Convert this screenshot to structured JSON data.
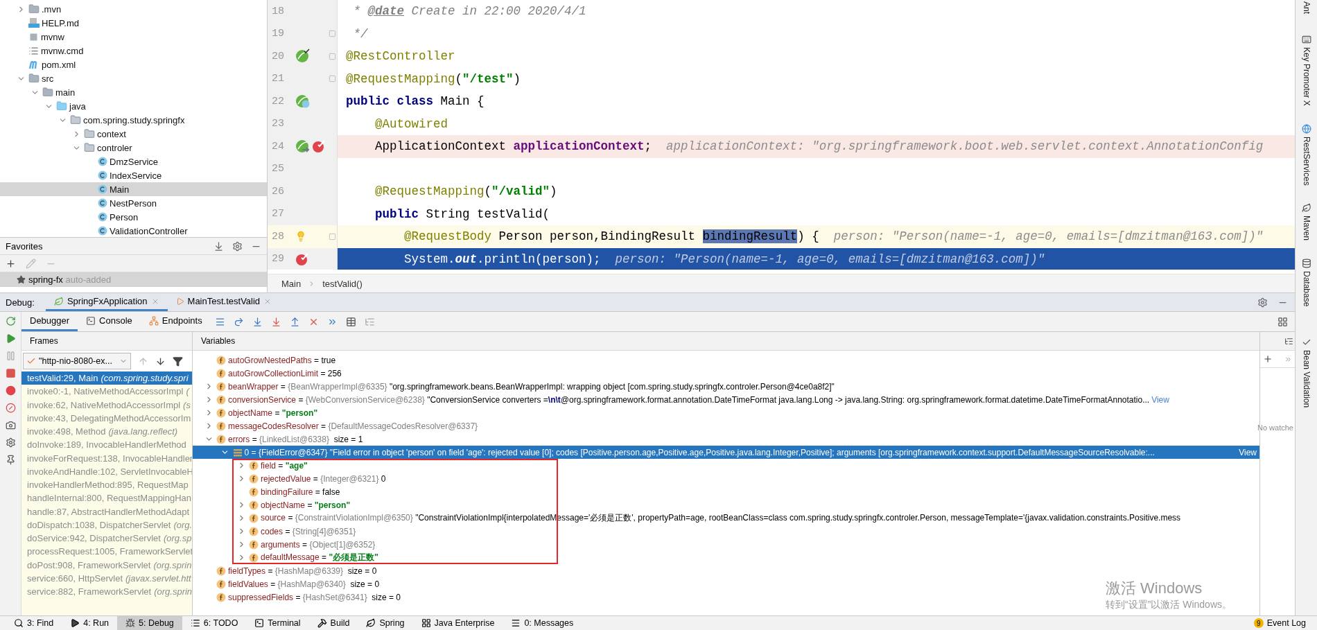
{
  "project": {
    "tree": [
      {
        "label": ".mvn",
        "kind": "folder",
        "expanded": false,
        "selected": false
      },
      {
        "label": "HELP.md",
        "kind": "markdown",
        "selected": false
      },
      {
        "label": "mvnw",
        "kind": "script",
        "selected": false
      },
      {
        "label": "mvnw.cmd",
        "kind": "cmd",
        "selected": false
      },
      {
        "label": "pom.xml",
        "kind": "maven",
        "selected": false
      },
      {
        "label": "src",
        "kind": "folder",
        "expanded": true,
        "selected": false,
        "children": [
          {
            "label": "main",
            "kind": "folder",
            "expanded": true,
            "selected": false,
            "children": [
              {
                "label": "java",
                "kind": "source-folder",
                "expanded": true,
                "selected": false,
                "children": [
                  {
                    "label": "com.spring.study.springfx",
                    "kind": "package",
                    "expanded": true,
                    "selected": false,
                    "children": [
                      {
                        "label": "context",
                        "kind": "package",
                        "expanded": false,
                        "selected": false
                      },
                      {
                        "label": "controler",
                        "kind": "package",
                        "expanded": true,
                        "selected": false,
                        "children": [
                          {
                            "label": "DmzService",
                            "kind": "class",
                            "selected": false
                          },
                          {
                            "label": "IndexService",
                            "kind": "class",
                            "selected": false
                          },
                          {
                            "label": "Main",
                            "kind": "class",
                            "selected": true
                          },
                          {
                            "label": "NestPerson",
                            "kind": "class",
                            "selected": false
                          },
                          {
                            "label": "Person",
                            "kind": "class",
                            "selected": false
                          },
                          {
                            "label": "ValidationController",
                            "kind": "class",
                            "selected": false
                          }
                        ]
                      }
                    ]
                  }
                ]
              }
            ]
          }
        ]
      }
    ]
  },
  "favorites": {
    "title": "Favorites",
    "items": [
      {
        "label": "spring-fx",
        "note": "auto-added",
        "selected": true
      }
    ]
  },
  "editor": {
    "lines": [
      {
        "number": "18",
        "kind": "normal",
        "segments": [
          {
            "kind": "comment",
            "text": " * "
          },
          {
            "kind": "doctag",
            "text": "@date"
          },
          {
            "kind": "comment",
            "text": " Create in 22:00 2020/4/1"
          }
        ]
      },
      {
        "number": "19",
        "kind": "normal",
        "fold": true,
        "segments": [
          {
            "kind": "comment",
            "text": " */"
          }
        ]
      },
      {
        "number": "20",
        "kind": "normal",
        "fold": true,
        "gutter": [
          {
            "kind": "bean-check"
          }
        ],
        "segments": [
          {
            "kind": "annotation",
            "text": "@RestController"
          }
        ]
      },
      {
        "number": "21",
        "kind": "normal",
        "fold": true,
        "segments": [
          {
            "kind": "annotation",
            "text": "@RequestMapping"
          },
          {
            "kind": "plain",
            "text": "("
          },
          {
            "kind": "string",
            "text": "\"/test\""
          },
          {
            "kind": "plain",
            "text": ")"
          }
        ]
      },
      {
        "number": "22",
        "kind": "normal",
        "gutter": [
          {
            "kind": "bean-class"
          }
        ],
        "segments": [
          {
            "kind": "keyword",
            "text": "public class"
          },
          {
            "kind": "plain",
            "text": " Main {"
          }
        ]
      },
      {
        "number": "23",
        "kind": "normal",
        "segments": [
          {
            "kind": "annotation",
            "text": "    @Autowired"
          }
        ]
      },
      {
        "number": "24",
        "kind": "breakpoint",
        "gutter": [
          {
            "kind": "bean-arrow"
          },
          {
            "kind": "breakpoint"
          }
        ],
        "segments": [
          {
            "kind": "plain",
            "text": "    ApplicationContext "
          },
          {
            "kind": "field",
            "text": "applicationContext"
          },
          {
            "kind": "plain",
            "text": ";"
          }
        ],
        "hint": "applicationContext: \"org.springframework.boot.web.servlet.context.AnnotationConfig"
      },
      {
        "number": "25",
        "kind": "normal"
      },
      {
        "number": "26",
        "kind": "normal",
        "segments": [
          {
            "kind": "annotation",
            "text": "    @RequestMapping"
          },
          {
            "kind": "plain",
            "text": "("
          },
          {
            "kind": "string",
            "text": "\"/valid\""
          },
          {
            "kind": "plain",
            "text": ")"
          }
        ]
      },
      {
        "number": "27",
        "kind": "normal",
        "segments": [
          {
            "kind": "keyword",
            "text": "    public"
          },
          {
            "kind": "plain",
            "text": " String testValid("
          }
        ]
      },
      {
        "number": "28",
        "kind": "current",
        "fold": true,
        "gutter": [
          {
            "kind": "bulb"
          }
        ],
        "segments": [
          {
            "kind": "annotation",
            "text": "        @RequestBody"
          },
          {
            "kind": "plain",
            "text": " Person person,BindingResult "
          },
          {
            "kind": "selection",
            "text": "bindingResult"
          },
          {
            "kind": "plain",
            "text": ") {"
          }
        ],
        "hint": "person: \"Person(name=-1, age=0, emails=[dmzitman@163.com])\""
      },
      {
        "number": "29",
        "kind": "execution",
        "gutter": [
          {
            "kind": "breakpoint"
          }
        ],
        "segments": [
          {
            "kind": "plain",
            "text": "        System."
          },
          {
            "kind": "static",
            "text": "out"
          },
          {
            "kind": "plain",
            "text": ".println(person);"
          }
        ],
        "hint": "person: \"Person(name=-1, age=0, emails=[dmzitman@163.com])\""
      }
    ],
    "breadcrumb": [
      "Main",
      "testValid()"
    ]
  },
  "right_toolbar": {
    "top": [
      "Ant",
      "Key Promoter X",
      "RestServices",
      "Maven",
      "Database"
    ],
    "bottom": [
      "Bean Validation"
    ]
  },
  "debug": {
    "label": "Debug:",
    "sessions": [
      {
        "label": "SpringFxApplication",
        "kind": "app",
        "selected": true
      },
      {
        "label": "MainTest.testValid",
        "kind": "test",
        "selected": false
      }
    ],
    "tabs": [
      {
        "label": "Debugger",
        "kind": "debugger",
        "selected": true
      },
      {
        "label": "Console",
        "kind": "console",
        "selected": false
      },
      {
        "label": "Endpoints",
        "kind": "endpoints",
        "selected": false
      }
    ],
    "frames": {
      "title": "Frames",
      "thread": "\"http-nio-8080-ex...",
      "items": [
        {
          "method": "testValid:29, Main",
          "package": "(com.spring.study.spri",
          "selected": true
        },
        {
          "method": "invoke0:-1, NativeMethodAccessorImpl",
          "package": "(",
          "selected": false
        },
        {
          "method": "invoke:62, NativeMethodAccessorImpl",
          "package": "(s",
          "selected": false
        },
        {
          "method": "invoke:43, DelegatingMethodAccessorIm",
          "selected": false
        },
        {
          "method": "invoke:498, Method",
          "package": "(java.lang.reflect)",
          "selected": false
        },
        {
          "method": "doInvoke:189, InvocableHandlerMethod",
          "selected": false
        },
        {
          "method": "invokeForRequest:138, InvocableHandler",
          "selected": false
        },
        {
          "method": "invokeAndHandle:102, ServletInvocableH",
          "selected": false
        },
        {
          "method": "invokeHandlerMethod:895, RequestMap",
          "selected": false
        },
        {
          "method": "handleInternal:800, RequestMappingHan",
          "selected": false
        },
        {
          "method": "handle:87, AbstractHandlerMethodAdapt",
          "selected": false
        },
        {
          "method": "doDispatch:1038, DispatcherServlet",
          "package": "(org.",
          "selected": false
        },
        {
          "method": "doService:942, DispatcherServlet",
          "package": "(org.sp",
          "selected": false
        },
        {
          "method": "processRequest:1005, FrameworkServlet",
          "selected": false
        },
        {
          "method": "doPost:908, FrameworkServlet",
          "package": "(org.sprin",
          "selected": false
        },
        {
          "method": "service:660, HttpServlet",
          "package": "(javax.servlet.htt",
          "selected": false
        },
        {
          "method": "service:882, FrameworkServlet",
          "package": "(org.sprin",
          "selected": false
        }
      ]
    },
    "variables": {
      "title": "Variables",
      "items": [
        {
          "name": "autoGrowNestedPaths",
          "kind": "field",
          "op": "=",
          "value": "true",
          "string": false,
          "selected": false
        },
        {
          "name": "autoGrowCollectionLimit",
          "kind": "field",
          "op": "=",
          "value": "256",
          "string": false,
          "selected": false
        },
        {
          "name": "beanWrapper",
          "kind": "field",
          "op": "=",
          "type": "{BeanWrapperImpl@6335}",
          "value": "\"org.springframework.beans.BeanWrapperImpl: wrapping object [com.spring.study.springfx.controler.Person@4ce0a8f2]\"",
          "string": false,
          "expanded": false,
          "selected": false
        },
        {
          "name": "conversionService",
          "kind": "field",
          "op": "=",
          "type": "{WebConversionService@6238}",
          "value": "\"ConversionService converters =**\\n\\t**@org.springframework.format.annotation.DateTimeFormat java.lang.Long -> java.lang.String: org.springframework.format.datetime.DateTimeFormatAnnotatio...",
          "string": false,
          "link": "View",
          "expanded": false,
          "selected": false
        },
        {
          "name": "objectName",
          "kind": "field",
          "op": "=",
          "value": "\"person\"",
          "string": true,
          "expanded": false,
          "selected": false
        },
        {
          "name": "messageCodesResolver",
          "kind": "field",
          "op": "=",
          "type": "{DefaultMessageCodesResolver@6337}",
          "expanded": false,
          "selected": false
        },
        {
          "name": "errors",
          "kind": "field",
          "op": "=",
          "type": "{LinkedList@6338}",
          "extra": "size = 1",
          "expanded": true,
          "selected": false,
          "children": [
            {
              "name": "0",
              "kind": "element",
              "op": "=",
              "type": "{FieldError@6347}",
              "value": "\"Field error in object 'person' on field 'age': rejected value [0]; codes [Positive.person.age,Positive.age,Positive.java.lang.Integer,Positive]; arguments [org.springframework.context.support.DefaultMessageSourceResolvable:...",
              "string": false,
              "link": "View",
              "expanded": true,
              "selected": true,
              "outlined": true,
              "children": [
                {
                  "name": "field",
                  "kind": "field",
                  "op": "=",
                  "value": "\"age\"",
                  "string": true,
                  "expanded": false,
                  "selected": false
                },
                {
                  "name": "rejectedValue",
                  "kind": "field",
                  "op": "=",
                  "type": "{Integer@6321}",
                  "value": "0",
                  "string": false,
                  "expanded": false,
                  "selected": false
                },
                {
                  "name": "bindingFailure",
                  "kind": "field",
                  "op": "=",
                  "value": "false",
                  "string": false,
                  "selected": false
                },
                {
                  "name": "objectName",
                  "kind": "field",
                  "op": "=",
                  "value": "\"person\"",
                  "string": true,
                  "expanded": false,
                  "selected": false
                },
                {
                  "name": "source",
                  "kind": "field",
                  "op": "=",
                  "type": "{ConstraintViolationImpl@6350}",
                  "value": "\"ConstraintViolationImpl{interpolatedMessage='必须是正数', propertyPath=age, rootBeanClass=class com.spring.study.springfx.controler.Person, messageTemplate='{javax.validation.constraints.Positive.mess",
                  "string": false,
                  "expanded": false,
                  "selected": false
                },
                {
                  "name": "codes",
                  "kind": "field",
                  "op": "=",
                  "type": "{String[4]@6351}",
                  "expanded": false,
                  "selected": false
                },
                {
                  "name": "arguments",
                  "kind": "field",
                  "op": "=",
                  "type": "{Object[1]@6352}",
                  "expanded": false,
                  "selected": false
                },
                {
                  "name": "defaultMessage",
                  "kind": "field",
                  "op": "=",
                  "value": "\"必须是正数\"",
                  "string": true,
                  "expanded": false,
                  "selected": false
                }
              ]
            }
          ]
        },
        {
          "name": "fieldTypes",
          "kind": "field",
          "op": "=",
          "type": "{HashMap@6339}",
          "extra": "size = 0",
          "selected": false
        },
        {
          "name": "fieldValues",
          "kind": "field",
          "op": "=",
          "type": "{HashMap@6340}",
          "extra": "size = 0",
          "selected": false
        },
        {
          "name": "suppressedFields",
          "kind": "field",
          "op": "=",
          "type": "{HashSet@6341}",
          "extra": "size = 0",
          "selected": false
        }
      ]
    },
    "watches": {
      "empty_text": "No watche"
    }
  },
  "windows_notice": {
    "title": "激活 Windows",
    "subtitle": "转到“设置”以激活 Windows。"
  },
  "status_bar": {
    "tools": [
      {
        "label": "3: Find",
        "kind": "search",
        "selected": false
      },
      {
        "label": "4: Run",
        "kind": "run",
        "selected": false
      },
      {
        "label": "5: Debug",
        "kind": "debug",
        "selected": true
      },
      {
        "label": "6: TODO",
        "kind": "todo",
        "selected": false
      },
      {
        "label": "Terminal",
        "kind": "terminal",
        "selected": false
      },
      {
        "label": "Build",
        "kind": "build",
        "selected": false
      },
      {
        "label": "Spring",
        "kind": "spring",
        "selected": false
      },
      {
        "label": "Java Enterprise",
        "kind": "javaee",
        "selected": false
      },
      {
        "label": "0: Messages",
        "kind": "messages",
        "selected": false
      }
    ],
    "event_log": {
      "label": "Event Log",
      "count": "9"
    }
  }
}
